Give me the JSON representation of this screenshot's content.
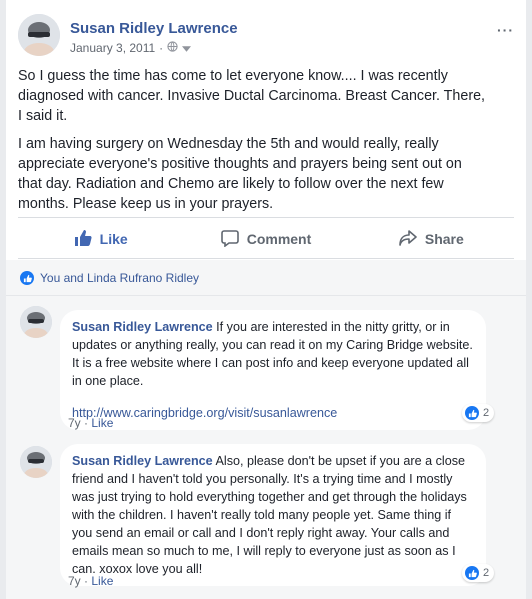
{
  "post": {
    "author": "Susan Ridley Lawrence",
    "date": "January 3, 2011",
    "date_separator": "·",
    "paragraphs": [
      "So I guess the time has come to let everyone know.... I was recently diagnosed with cancer. Invasive Ductal Carcinoma. Breast Cancer. There, I said it.",
      "I am having surgery on Wednesday the 5th and would really, really appreciate everyone's positive thoughts and prayers being sent out on that day. Radiation and Chemo are likely to follow over the next few months. Please keep us in your prayers."
    ]
  },
  "actions": {
    "like": "Like",
    "comment": "Comment",
    "share": "Share"
  },
  "reactions": {
    "summary": "You and Linda Rufrano Ridley"
  },
  "comments": [
    {
      "author": "Susan Ridley Lawrence",
      "text": " If you are interested in the nitty gritty, or in updates or anything really, you can read it on my Caring Bridge website. It is a free website where I can post info and keep everyone updated all in one place.",
      "link": "http://www.caringbridge.org/visit/susanlawrence",
      "age": "7y",
      "like_label": "Like",
      "reaction_count": "2"
    },
    {
      "author": "Susan Ridley Lawrence",
      "text": " Also, please don't be upset if you are a close friend and I haven't told you personally. It's a trying time and I mostly was just trying to hold everything together and get through the holidays with the children. I haven't really told many people yet. Same thing if you send an email or call and I don't reply right away. Your calls and emails mean so much to me, I will reply to everyone just as soon as I can. xoxox love you all!",
      "link": "",
      "age": "7y",
      "like_label": "Like",
      "reaction_count": "2"
    }
  ],
  "colors": {
    "link": "#385898",
    "like_blue": "#4267b2",
    "reaction_blue": "#1877f2",
    "background": "#e9ebee"
  },
  "icons": [
    "avatar-photo",
    "globe-icon",
    "chevron-down-icon",
    "more-icon",
    "thumbs-up-icon",
    "comment-icon",
    "share-icon",
    "like-reaction-icon"
  ]
}
